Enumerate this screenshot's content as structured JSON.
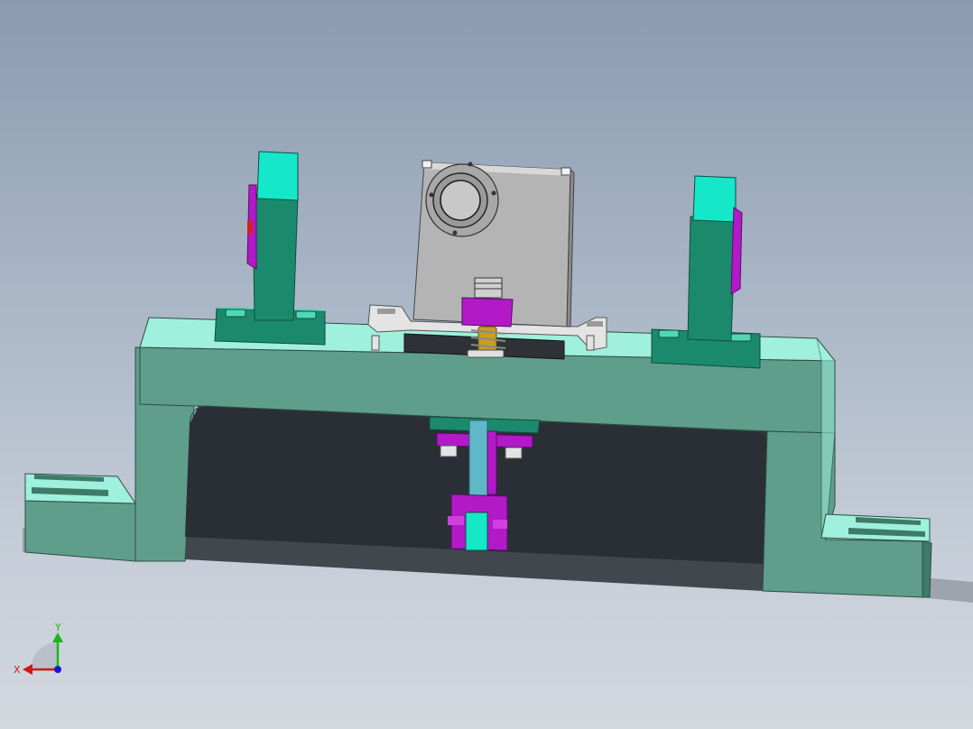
{
  "viewport": {
    "background_top": "#8a9ab0",
    "background_bottom": "#d3d8df"
  },
  "palette": {
    "teal_light": "#9ff0dc",
    "teal_mid": "#5f9e8a",
    "teal_dark": "#3e7a68",
    "teal_top": "#49a88a",
    "cyan_cap": "#14e8c8",
    "magenta": "#b21ac8",
    "magenta_dark": "#7a0f8a",
    "gray_plate": "#b4b4b4",
    "gray_light": "#e4e4e4",
    "dark_plate": "#2e3236",
    "brass": "#c8a020",
    "shaft": "#5fb8c8"
  },
  "triad": {
    "x_label": "X",
    "y_label": "Y",
    "x_color": "#d01818",
    "y_color": "#18b818",
    "z_color": "#1818d0"
  }
}
